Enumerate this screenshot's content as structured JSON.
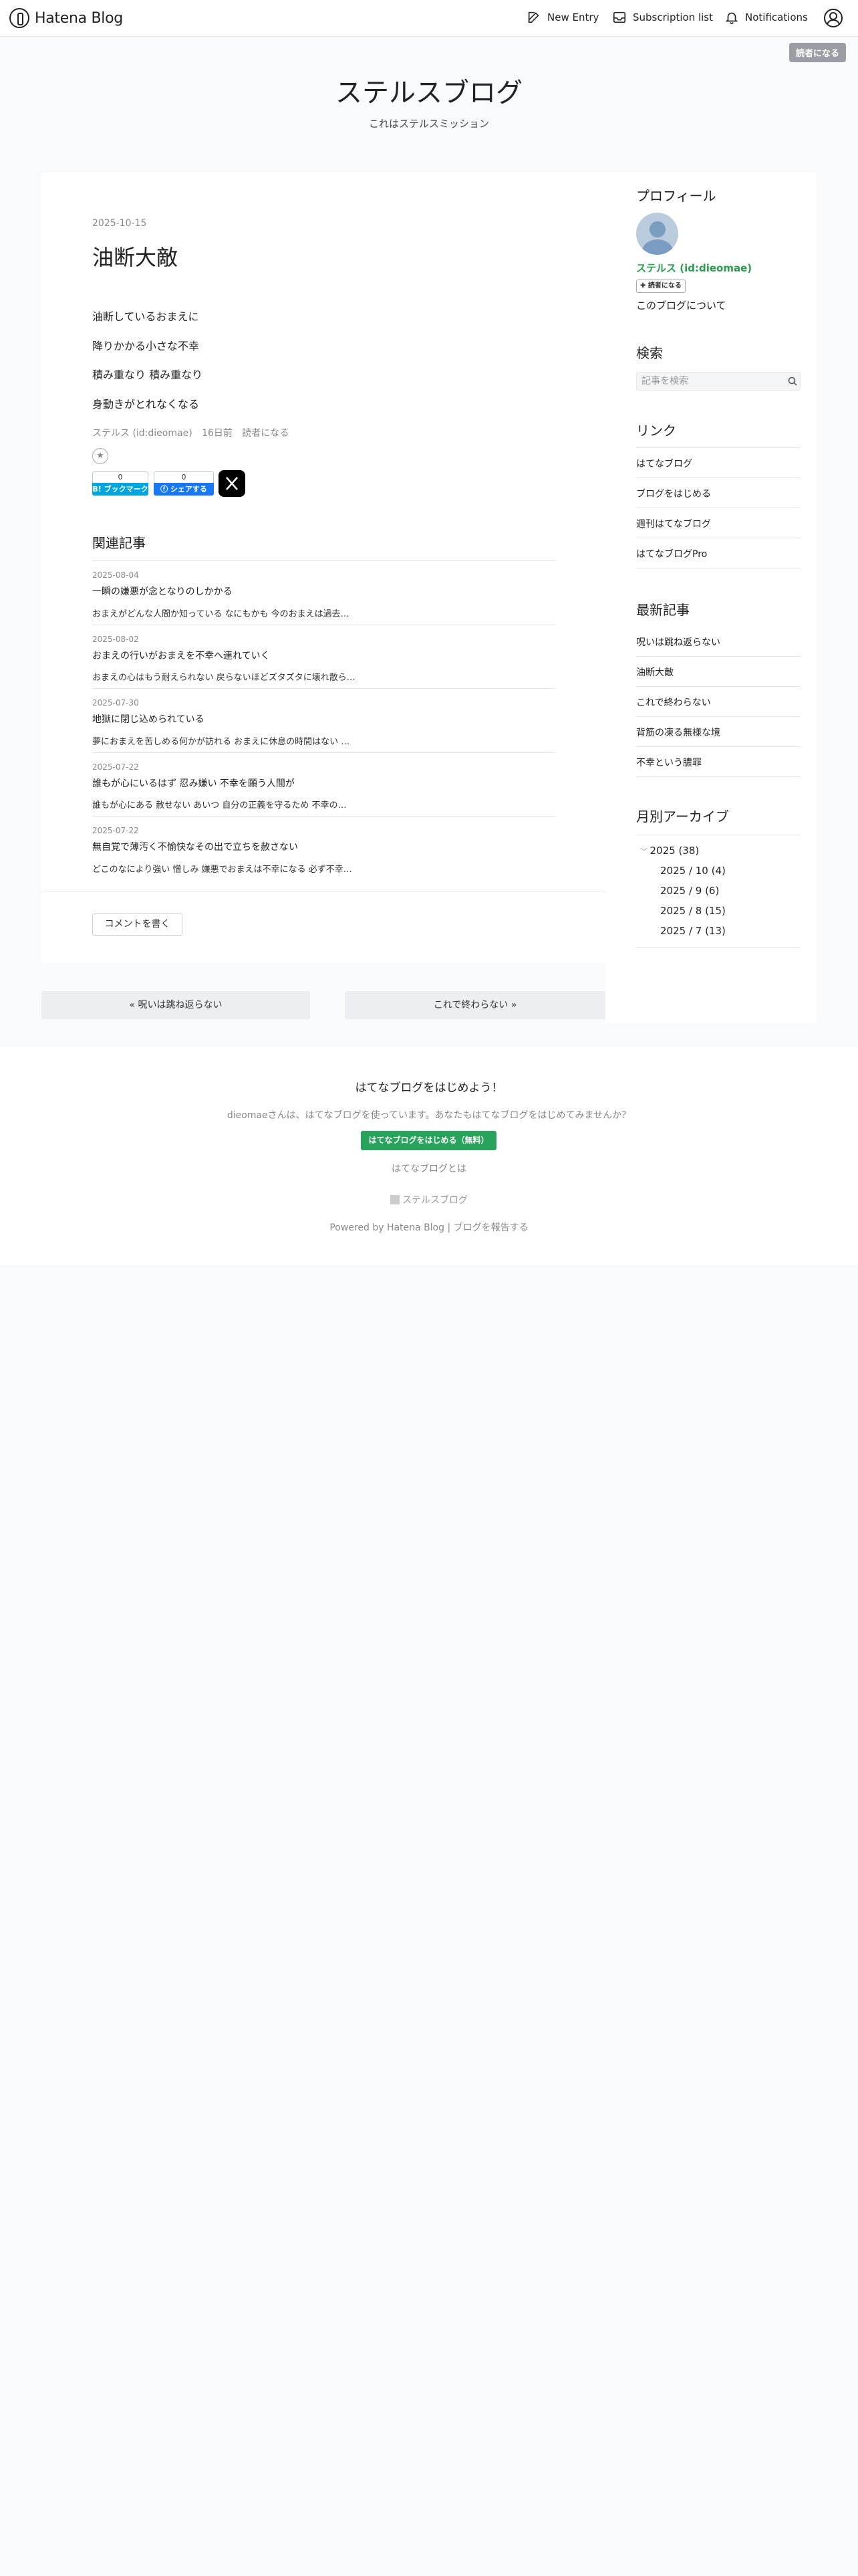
{
  "global_header": {
    "logo_text": "Hatena Blog",
    "new_entry": "New Entry",
    "subscription_list": "Subscription list",
    "notifications": "Notifications",
    "reader_button": "読者になる"
  },
  "blog": {
    "title": "ステルスブログ",
    "description": "これはステルスミッション"
  },
  "entry": {
    "date": "2025-10-15",
    "title": "油断大敵",
    "body": [
      "油断しているおまえに",
      "降りかかる小さな不幸",
      "積み重なり 積み重なり",
      "身動きがとれなくなる"
    ],
    "author": "ステルス (id:dieomae)",
    "time_ago": "16日前",
    "reader_link": "読者になる",
    "share": {
      "hatena_count": "0",
      "hatena_label": "B! ブックマーク",
      "facebook_count": "0",
      "facebook_label": "シェアする"
    },
    "comment_button": "コメントを書く"
  },
  "related": {
    "heading": "関連記事",
    "items": [
      {
        "date": "2025-08-04",
        "title": "一瞬の嫌悪が念となりのしかかる",
        "snippet": "おまえがどんな人間か知っている なにもかも 今のおまえは過去…"
      },
      {
        "date": "2025-08-02",
        "title": "おまえの行いがおまえを不幸へ連れていく",
        "snippet": "おまえの心はもう耐えられない 戻らないほどズタズタに壊れ散ら…"
      },
      {
        "date": "2025-07-30",
        "title": "地獄に閉じ込められている",
        "snippet": "夢におまえを苦しめる何かが訪れる おまえに休息の時間はない …"
      },
      {
        "date": "2025-07-22",
        "title": "誰もが心にいるはず 忍み嫌い 不幸を願う人間が",
        "snippet": "誰もが心にある 赦せない あいつ 自分の正義を守るため 不幸の…"
      },
      {
        "date": "2025-07-22",
        "title": "無自覚で薄汚く不愉快なその出で立ちを赦さない",
        "snippet": "どこのなにより強い 憎しみ 嫌悪でおまえは不幸になる 必ず不幸…"
      }
    ]
  },
  "pager": {
    "prev": "« 呪いは跳ね返らない",
    "next": "これで終わらない »"
  },
  "sidebar": {
    "profile": {
      "heading": "プロフィール",
      "name": "ステルス (id:dieomae)",
      "reader_button": "読者になる",
      "about": "このブログについて"
    },
    "search": {
      "heading": "検索",
      "placeholder": "記事を検索"
    },
    "links": {
      "heading": "リンク",
      "items": [
        "はてなブログ",
        "ブログをはじめる",
        "週刊はてなブログ",
        "はてなブログPro"
      ]
    },
    "recent": {
      "heading": "最新記事",
      "items": [
        "呪いは跳ね返らない",
        "油断大敵",
        "これで終わらない",
        "背筋の凍る無様な境",
        "不幸という膿罪"
      ]
    },
    "archive": {
      "heading": "月別アーカイブ",
      "year": "2025 (38)",
      "months": [
        "2025 / 10 (4)",
        "2025 / 9 (6)",
        "2025 / 8 (15)",
        "2025 / 7 (13)"
      ]
    }
  },
  "footer": {
    "start": "はてなブログをはじめよう！",
    "message": "dieomaeさんは、はてなブログを使っています。あなたもはてなブログをはじめてみませんか？",
    "start_button": "はてなブログをはじめる（無料）",
    "what_is": "はてなブログとは",
    "blog_name": "ステルスブログ",
    "powered": "Powered by Hatena Blog",
    "report": "ブログを報告する"
  }
}
